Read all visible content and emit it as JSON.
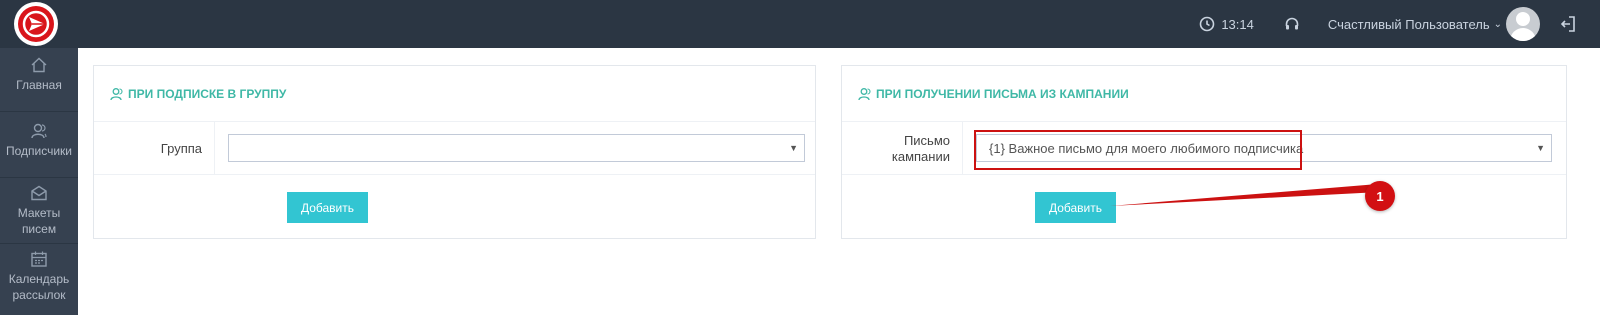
{
  "header": {
    "time": "13:14",
    "user_name": "Счастливый Пользователь"
  },
  "sidebar": {
    "items": [
      {
        "label": "Главная",
        "icon": "home-icon"
      },
      {
        "label": "Подписчики",
        "icon": "users-icon"
      },
      {
        "label": "Макеты писем",
        "icon": "envelope-icon"
      },
      {
        "label": "Календарь рассылок",
        "icon": "calendar-icon"
      }
    ]
  },
  "panels": {
    "left": {
      "title": "ПРИ ПОДПИСКЕ В ГРУППУ",
      "field_label": "Группа",
      "field_value": "",
      "button_label": "Добавить"
    },
    "right": {
      "title": "ПРИ ПОЛУЧЕНИИ ПИСЬМА ИЗ КАМПАНИИ",
      "field_label_line1": "Письмо",
      "field_label_line2": "кампании",
      "field_value": "{1} Важное письмо для моего любимого подписчика",
      "button_label": "Добавить"
    }
  },
  "annotation": {
    "badge": "1"
  },
  "colors": {
    "topbar": "#2b3643",
    "sidebar": "#364150",
    "accent_teal": "#3fb8a6",
    "button": "#32c5d2",
    "annotation_red": "#d20f12"
  }
}
